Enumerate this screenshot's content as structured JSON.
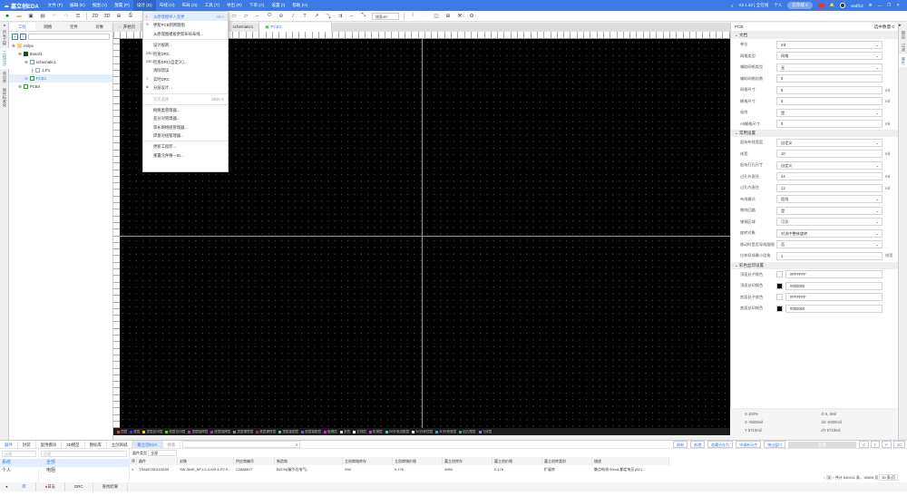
{
  "app": {
    "name": "嘉立创EDA",
    "version": "V2.1.42 | 全在线",
    "mode": "个人",
    "cloud": "云存储 0",
    "user": "vedf13"
  },
  "menubar": [
    "文件 (F)",
    "编辑 (E)",
    "视图 (V)",
    "放置 (P)",
    "设计 (D)",
    "布线 (U)",
    "布局 (O)",
    "工具 (T)",
    "导出 (R)",
    "下单 (A)",
    "设置 (I)",
    "帮助 (H)"
  ],
  "toolbar": {
    "view2d": "2D",
    "view3d": "3D",
    "angle": "线条45°"
  },
  "design_menu": [
    {
      "icon": "import-icon",
      "label": "从原理图导入变更",
      "shortcut": "Alt+I",
      "highlight": true
    },
    {
      "icon": "update-icon",
      "label": "更新PCB到原理图"
    },
    {
      "icon": "",
      "label": "从原理图模板更新布局布线..."
    },
    {
      "sep": true
    },
    {
      "icon": "",
      "label": "设计规则..."
    },
    {
      "icon": "DRC",
      "label": "检查DRC"
    },
    {
      "icon": "DRC",
      "label": "检查DRC(自定义)..."
    },
    {
      "icon": "",
      "label": "清除错误"
    },
    {
      "icon": "✓",
      "label": "实时DRC"
    },
    {
      "icon": "layer-icon",
      "label": "分层设计..."
    },
    {
      "sep": true
    },
    {
      "icon": "",
      "label": "交叉选择",
      "shortcut": "Shift+X",
      "disabled": true
    },
    {
      "sep": true
    },
    {
      "icon": "",
      "label": "网络类管理器..."
    },
    {
      "icon": "",
      "label": "差分对管理器..."
    },
    {
      "icon": "",
      "label": "等长网络组管理器..."
    },
    {
      "icon": "",
      "label": "焊盘对组管理器..."
    },
    {
      "sep": true
    },
    {
      "icon": "",
      "label": "更新工程库..."
    },
    {
      "icon": "",
      "label": "重置元件唯一ID..."
    }
  ],
  "left_strip": [
    "所有工程",
    "工程设计",
    "常用库",
    "器件标准化"
  ],
  "left_panel": {
    "tabs": [
      "工程",
      "网络",
      "元件",
      "对象"
    ],
    "tree": [
      {
        "label": "Anlya",
        "level": 0
      },
      {
        "label": "Board1",
        "level": 1
      },
      {
        "label": "schematic1",
        "level": 2
      },
      {
        "label": "1.P1",
        "level": 3
      },
      {
        "label": "PCB1",
        "level": 2,
        "selected": true
      },
      {
        "label": "PCB4",
        "level": 1
      }
    ]
  },
  "doc_tabs": [
    "开始页",
    "schematic1",
    "PCB1"
  ],
  "layers": [
    {
      "name": "顶层",
      "color": "#ff3333"
    },
    {
      "name": "底层",
      "color": "#3333ff"
    },
    {
      "name": "顶层丝印层",
      "color": "#ffcc00"
    },
    {
      "name": "底层丝印层",
      "color": "#66cc00"
    },
    {
      "name": "顶层阻焊层",
      "color": "#aa33aa"
    },
    {
      "name": "底层阻焊层",
      "color": "#9933cc"
    },
    {
      "name": "顶层锡膏层",
      "color": "#888888"
    },
    {
      "name": "底层锡膏层",
      "color": "#993333"
    },
    {
      "name": "顶层装配层",
      "color": "#33cc99"
    },
    {
      "name": "底层装配层",
      "color": "#6666cc"
    },
    {
      "name": "板框层",
      "color": "#ff00ff"
    },
    {
      "name": "多层",
      "color": "#cccccc"
    },
    {
      "name": "文档层",
      "color": "#ffffff"
    },
    {
      "name": "机械层",
      "color": "#cc33cc"
    },
    {
      "name": "3D外壳边框层",
      "color": "#33cccc"
    },
    {
      "name": "3D外壳顶层",
      "color": "#dddddd"
    },
    {
      "name": "3D外壳底层",
      "color": "#3399ff"
    },
    {
      "name": "钻孔图层",
      "color": "#33aa66"
    },
    {
      "name": "飞线层",
      "color": "#9966ff"
    }
  ],
  "right_panel": {
    "title": "PCB",
    "selected_count": "选中数量 0",
    "sections": [
      {
        "title": "文档",
        "rows": [
          {
            "label": "单位",
            "value": "mil",
            "type": "select"
          },
          {
            "label": "网格类型",
            "value": "网格",
            "type": "select"
          },
          {
            "label": "辅助网格类型",
            "value": "无",
            "type": "select"
          },
          {
            "label": "辅助网格倍数",
            "value": "5"
          },
          {
            "label": "网格尺寸",
            "value": "5",
            "unit": "mil"
          },
          {
            "label": "栅格尺寸",
            "value": "5",
            "unit": "mil"
          },
          {
            "label": "吸附",
            "value": "是",
            "type": "select"
          },
          {
            "label": "Alt栅格尺寸",
            "value": "5",
            "unit": "mil"
          }
        ]
      },
      {
        "title": "常用设置",
        "rows": [
          {
            "label": "起始布线宽度",
            "value": "自定义",
            "type": "select"
          },
          {
            "label": "线宽",
            "value": "10",
            "unit": "mil"
          },
          {
            "label": "起始打孔尺寸",
            "value": "自定义",
            "type": "select"
          },
          {
            "label": "过孔外直径",
            "value": "24",
            "unit": "mil"
          },
          {
            "label": "过孔内直径",
            "value": "12",
            "unit": "mil"
          },
          {
            "label": "布线模式",
            "value": "阻挡",
            "type": "select"
          },
          {
            "label": "移除回路",
            "value": "是",
            "type": "select"
          },
          {
            "label": "铺铜区域",
            "value": "可见",
            "type": "select"
          },
          {
            "label": "旋转对象",
            "value": "对选中整体旋转",
            "type": "select"
          },
          {
            "label": "移动时是否导线跟随",
            "value": "否",
            "type": "select"
          },
          {
            "label": "拉伸导线最小倍角",
            "value": "1",
            "unit": "线宽"
          }
        ]
      },
      {
        "title": "彩色丝印设置",
        "rows": [
          {
            "label": "顶面丝子颜色",
            "value": "#FFFFFF",
            "swatch": "#ffffff"
          },
          {
            "label": "顶面丝印颜色",
            "value": "#000000",
            "swatch": "#000000"
          },
          {
            "label": "底面丝子颜色",
            "value": "#FFFFFF",
            "swatch": "#ffffff"
          },
          {
            "label": "底面丝印颜色",
            "value": "#000000",
            "swatch": "#000000"
          }
        ]
      }
    ]
  },
  "right_strip": [
    "图层",
    "过滤",
    "属性"
  ],
  "coords": {
    "s": "S  100%",
    "g": "G  5, 5mil",
    "x": "X  -8305mil",
    "dx": "dX  -8305mil",
    "y": "Y  5710mil",
    "dy": "dY  5710mil"
  },
  "bottom": {
    "tabs": [
      "器件",
      "封装",
      "复用模块",
      "3D模型",
      "图标库",
      "立创商城",
      "嘉立创EDA",
      "搜索"
    ],
    "buttons": [
      "刷新",
      "新增",
      "收藏另存为",
      "申请新元件",
      "弹出窗口"
    ],
    "view_buttons": [
      "S",
      "F",
      "P",
      "3D"
    ],
    "preview_label": "放置",
    "filter_placeholder": "过滤",
    "lib_list": [
      "系统",
      "个人"
    ],
    "cat_list": [
      "全部",
      "电阻"
    ],
    "type_label": "器件类型",
    "type_value": "全部",
    "columns": [
      "序",
      "器件",
      "封装",
      "供应商编号",
      "制造商",
      "立创商城库存",
      "立创商城价格",
      "嘉立创库存",
      "嘉立创价格",
      "嘉立创库类别",
      "描述"
    ],
    "rows": [
      [
        "1",
        "TSA0078151SA03",
        "SW-SMD_6P-L3.4-W3.4-P2.0...",
        "C2888917",
        "BZCN(福尔达电气)",
        "298",
        "0.176",
        "4983",
        "0.176",
        "扩展库",
        "触点电流:50mA,额定电压(AC)..."
      ]
    ],
    "pagination": {
      "page": "1",
      "total": "共计 540411 条，10809 页",
      "per_page": "50 条/页"
    },
    "footer_tabs": [
      "库",
      "日志",
      "DRC",
      "查找结果"
    ]
  }
}
